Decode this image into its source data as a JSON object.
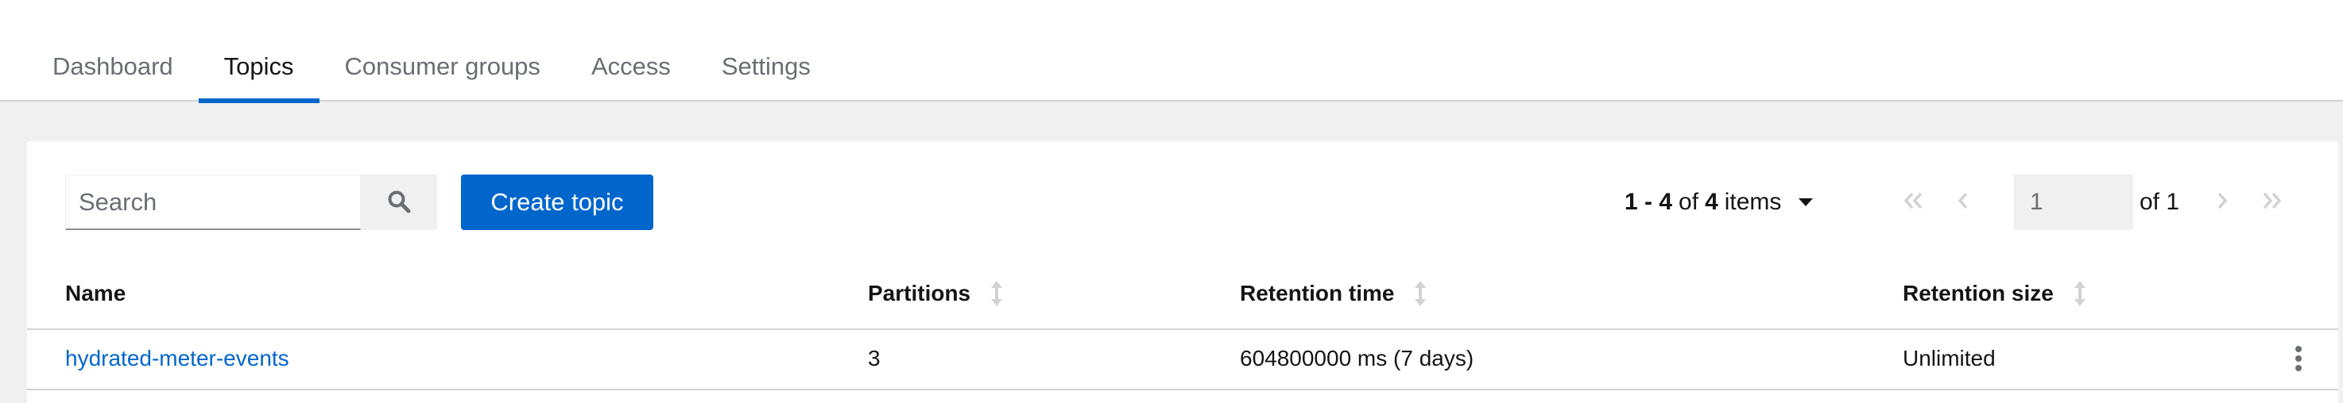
{
  "tabs": [
    {
      "label": "Dashboard",
      "active": false
    },
    {
      "label": "Topics",
      "active": true
    },
    {
      "label": "Consumer groups",
      "active": false
    },
    {
      "label": "Access",
      "active": false
    },
    {
      "label": "Settings",
      "active": false
    }
  ],
  "toolbar": {
    "search_placeholder": "Search",
    "search_value": "",
    "search_icon": "search-icon",
    "create_label": "Create topic"
  },
  "pagination": {
    "range": "1 - 4",
    "of_word": "of",
    "total": "4",
    "items_word": "items",
    "page": "1",
    "of_pages": "of 1",
    "icons": [
      "first-page-icon",
      "prev-page-icon",
      "next-page-icon",
      "last-page-icon"
    ]
  },
  "table": {
    "columns": [
      {
        "label": "Name",
        "sortable": false
      },
      {
        "label": "Partitions",
        "sortable": true
      },
      {
        "label": "Retention time",
        "sortable": true
      },
      {
        "label": "Retention size",
        "sortable": true
      }
    ],
    "rows": [
      {
        "name": "hydrated-meter-events",
        "partitions": "3",
        "retention_time": "604800000 ms (7 days)",
        "retention_size": "Unlimited",
        "actions_icon": "kebab-icon"
      }
    ]
  },
  "colors": {
    "accent": "#0066cc",
    "background": "#f0f0f0",
    "text": "#151515",
    "muted": "#6a6e73",
    "border": "#d2d2d2"
  }
}
